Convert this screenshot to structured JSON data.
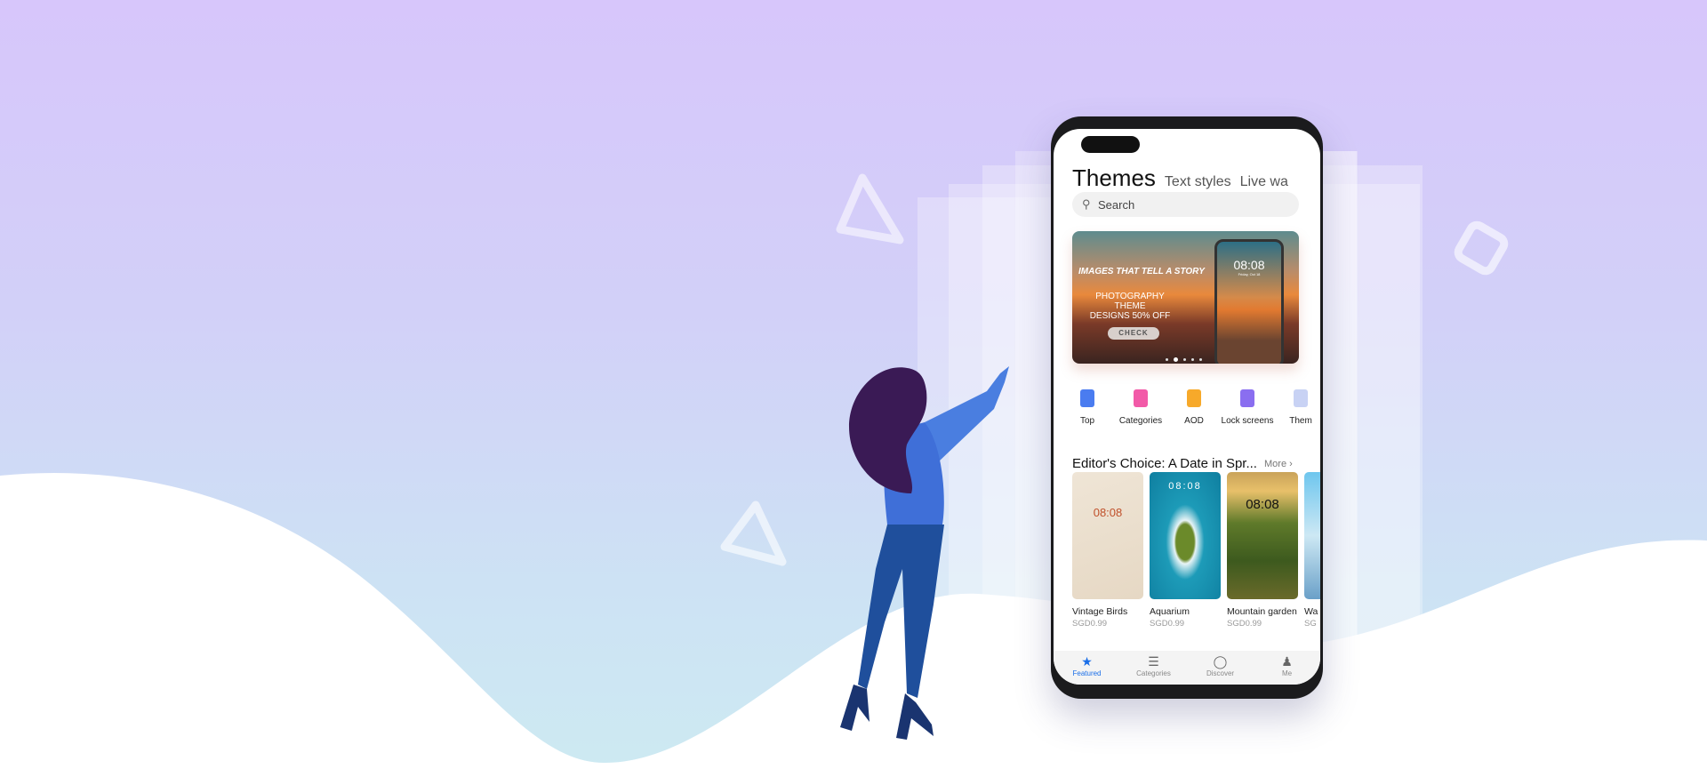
{
  "app": {
    "tabs": [
      {
        "label": "Themes",
        "active": true
      },
      {
        "label": "Text styles"
      },
      {
        "label": "Live wa"
      }
    ],
    "search": {
      "placeholder": "Search"
    },
    "banner": {
      "headline": "IMAGES THAT TELL A STORY",
      "subline1": "PHOTOGRAPHY THEME",
      "subline2": "DESIGNS 50% OFF",
      "button": "CHECK",
      "clock": "08:08",
      "date": "Friday, Oct 18",
      "page_count": 5,
      "active_page": 2
    },
    "shortcuts": [
      {
        "label": "Top",
        "icon": "chart-icon",
        "color": "#4a7cf0"
      },
      {
        "label": "Categories",
        "icon": "heart-card-icon",
        "color": "#f25aa8"
      },
      {
        "label": "AOD",
        "icon": "aod-icon",
        "color": "#f7a92a"
      },
      {
        "label": "Lock screens",
        "icon": "lock-icon",
        "color": "#8a6ef0"
      },
      {
        "label": "Them",
        "icon": "theme-icon",
        "color": "#a8b8f0"
      }
    ],
    "section": {
      "title": "Editor's Choice: A Date in Spr...",
      "more": "More"
    },
    "cards": [
      {
        "name": "Vintage Birds",
        "price": "SGD0.99",
        "clock": "08:08"
      },
      {
        "name": "Aquarium",
        "price": "SGD0.99",
        "clock": "08:08"
      },
      {
        "name": "Mountain garden",
        "price": "SGD0.99",
        "clock": "08:08"
      },
      {
        "name": "Wa",
        "price": "SG",
        "clock": ""
      }
    ],
    "nav": [
      {
        "label": "Featured",
        "active": true
      },
      {
        "label": "Categories"
      },
      {
        "label": "Discover"
      },
      {
        "label": "Me"
      }
    ],
    "colors": {
      "accent": "#1a6ee8",
      "bg_top": "#d7c6fb",
      "bg_bottom": "#cdeaf2"
    }
  }
}
